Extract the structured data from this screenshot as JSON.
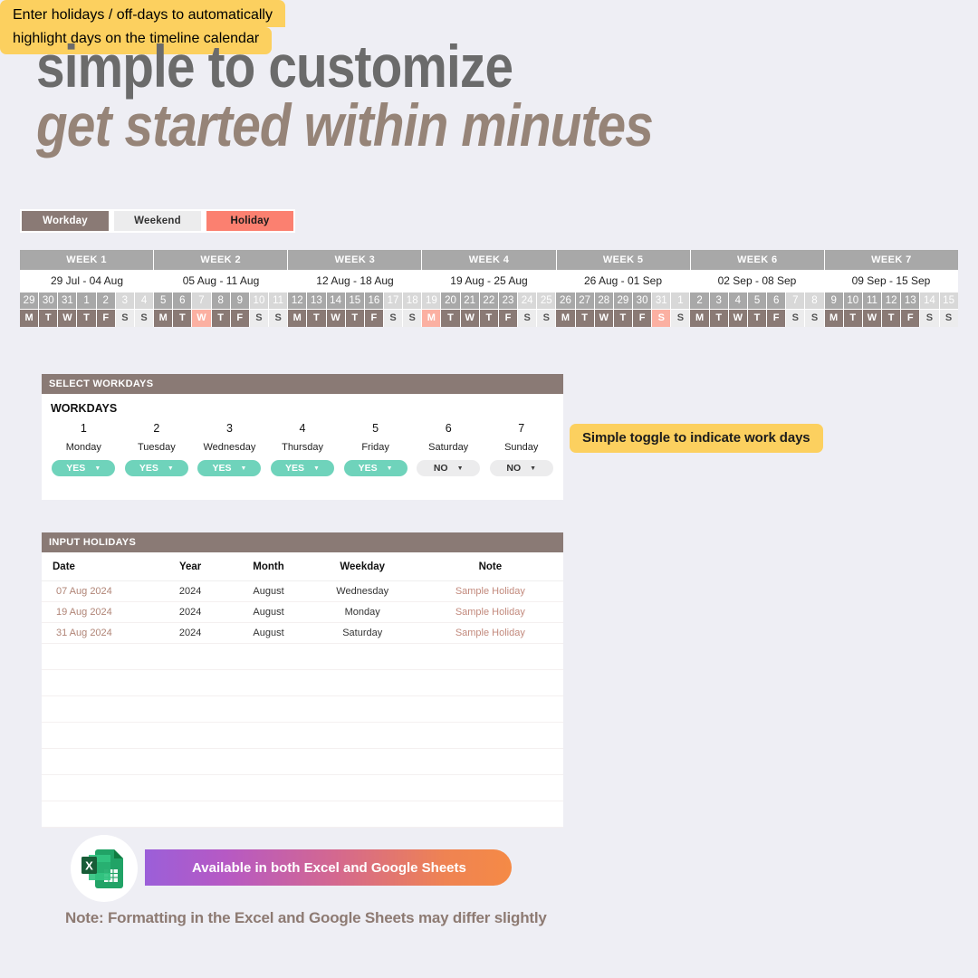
{
  "heading": {
    "line1": "simple to customize",
    "line2": "get started within minutes"
  },
  "legend": {
    "workday": "Workday",
    "weekend": "Weekend",
    "holiday": "Holiday"
  },
  "calendar": {
    "weeks": [
      {
        "label": "WEEK 1",
        "range": "29 Jul - 04 Aug"
      },
      {
        "label": "WEEK 2",
        "range": "05 Aug - 11 Aug"
      },
      {
        "label": "WEEK 3",
        "range": "12 Aug - 18 Aug"
      },
      {
        "label": "WEEK 4",
        "range": "19 Aug - 25 Aug"
      },
      {
        "label": "WEEK 5",
        "range": "26 Aug - 01 Sep"
      },
      {
        "label": "WEEK 6",
        "range": "02 Sep - 08 Sep"
      },
      {
        "label": "WEEK 7",
        "range": "09 Sep - 15 Sep"
      }
    ],
    "days": [
      {
        "num": "29",
        "wd": "M",
        "type": "workday"
      },
      {
        "num": "30",
        "wd": "T",
        "type": "workday"
      },
      {
        "num": "31",
        "wd": "W",
        "type": "workday"
      },
      {
        "num": "1",
        "wd": "T",
        "type": "workday"
      },
      {
        "num": "2",
        "wd": "F",
        "type": "workday"
      },
      {
        "num": "3",
        "wd": "S",
        "type": "weekend"
      },
      {
        "num": "4",
        "wd": "S",
        "type": "weekend"
      },
      {
        "num": "5",
        "wd": "M",
        "type": "workday"
      },
      {
        "num": "6",
        "wd": "T",
        "type": "workday"
      },
      {
        "num": "7",
        "wd": "W",
        "type": "holiday"
      },
      {
        "num": "8",
        "wd": "T",
        "type": "workday"
      },
      {
        "num": "9",
        "wd": "F",
        "type": "workday"
      },
      {
        "num": "10",
        "wd": "S",
        "type": "weekend"
      },
      {
        "num": "11",
        "wd": "S",
        "type": "weekend"
      },
      {
        "num": "12",
        "wd": "M",
        "type": "workday"
      },
      {
        "num": "13",
        "wd": "T",
        "type": "workday"
      },
      {
        "num": "14",
        "wd": "W",
        "type": "workday"
      },
      {
        "num": "15",
        "wd": "T",
        "type": "workday"
      },
      {
        "num": "16",
        "wd": "F",
        "type": "workday"
      },
      {
        "num": "17",
        "wd": "S",
        "type": "weekend"
      },
      {
        "num": "18",
        "wd": "S",
        "type": "weekend"
      },
      {
        "num": "19",
        "wd": "M",
        "type": "holiday"
      },
      {
        "num": "20",
        "wd": "T",
        "type": "workday"
      },
      {
        "num": "21",
        "wd": "W",
        "type": "workday"
      },
      {
        "num": "22",
        "wd": "T",
        "type": "workday"
      },
      {
        "num": "23",
        "wd": "F",
        "type": "workday"
      },
      {
        "num": "24",
        "wd": "S",
        "type": "weekend"
      },
      {
        "num": "25",
        "wd": "S",
        "type": "weekend"
      },
      {
        "num": "26",
        "wd": "M",
        "type": "workday"
      },
      {
        "num": "27",
        "wd": "T",
        "type": "workday"
      },
      {
        "num": "28",
        "wd": "W",
        "type": "workday"
      },
      {
        "num": "29",
        "wd": "T",
        "type": "workday"
      },
      {
        "num": "30",
        "wd": "F",
        "type": "workday"
      },
      {
        "num": "31",
        "wd": "S",
        "type": "holiday"
      },
      {
        "num": "1",
        "wd": "S",
        "type": "weekend"
      },
      {
        "num": "2",
        "wd": "M",
        "type": "workday"
      },
      {
        "num": "3",
        "wd": "T",
        "type": "workday"
      },
      {
        "num": "4",
        "wd": "W",
        "type": "workday"
      },
      {
        "num": "5",
        "wd": "T",
        "type": "workday"
      },
      {
        "num": "6",
        "wd": "F",
        "type": "workday"
      },
      {
        "num": "7",
        "wd": "S",
        "type": "weekend"
      },
      {
        "num": "8",
        "wd": "S",
        "type": "weekend"
      },
      {
        "num": "9",
        "wd": "M",
        "type": "workday"
      },
      {
        "num": "10",
        "wd": "T",
        "type": "workday"
      },
      {
        "num": "11",
        "wd": "W",
        "type": "workday"
      },
      {
        "num": "12",
        "wd": "T",
        "type": "workday"
      },
      {
        "num": "13",
        "wd": "F",
        "type": "workday"
      },
      {
        "num": "14",
        "wd": "S",
        "type": "weekend"
      },
      {
        "num": "15",
        "wd": "S",
        "type": "weekend"
      }
    ]
  },
  "workdays_panel": {
    "header": "SELECT WORKDAYS",
    "title": "WORKDAYS",
    "rows": [
      {
        "index": "1",
        "name": "Monday",
        "value": "YES"
      },
      {
        "index": "2",
        "name": "Tuesday",
        "value": "YES"
      },
      {
        "index": "3",
        "name": "Wednesday",
        "value": "YES"
      },
      {
        "index": "4",
        "name": "Thursday",
        "value": "YES"
      },
      {
        "index": "5",
        "name": "Friday",
        "value": "YES"
      },
      {
        "index": "6",
        "name": "Saturday",
        "value": "NO"
      },
      {
        "index": "7",
        "name": "Sunday",
        "value": "NO"
      }
    ]
  },
  "holidays_panel": {
    "header": "INPUT HOLIDAYS",
    "columns": [
      "Date",
      "Year",
      "Month",
      "Weekday",
      "Note"
    ],
    "rows": [
      {
        "date": "07 Aug 2024",
        "year": "2024",
        "month": "August",
        "weekday": "Wednesday",
        "note": "Sample Holiday"
      },
      {
        "date": "19 Aug 2024",
        "year": "2024",
        "month": "August",
        "weekday": "Monday",
        "note": "Sample Holiday"
      },
      {
        "date": "31 Aug 2024",
        "year": "2024",
        "month": "August",
        "weekday": "Saturday",
        "note": "Sample Holiday"
      }
    ],
    "empty_row_count": 7
  },
  "callouts": {
    "toggle": "Simple toggle to indicate work days",
    "holidays_line1": "Enter holidays / off-days to automatically",
    "holidays_line2": "highlight days on the timeline calendar"
  },
  "banner": {
    "text": "Available in both Excel and Google Sheets",
    "note": "Note: Formatting in the Excel and Google Sheets may differ slightly"
  },
  "colors": {
    "background": "#eeeef4",
    "workday": "#8a7a75",
    "weekend": "#ececed",
    "holiday": "#fb8070",
    "week_header": "#a8a8a8",
    "toggle_yes": "#6fd3bb",
    "callout": "#fcd05f",
    "heading_primary": "#6b6b6b",
    "heading_secondary": "#968478"
  }
}
